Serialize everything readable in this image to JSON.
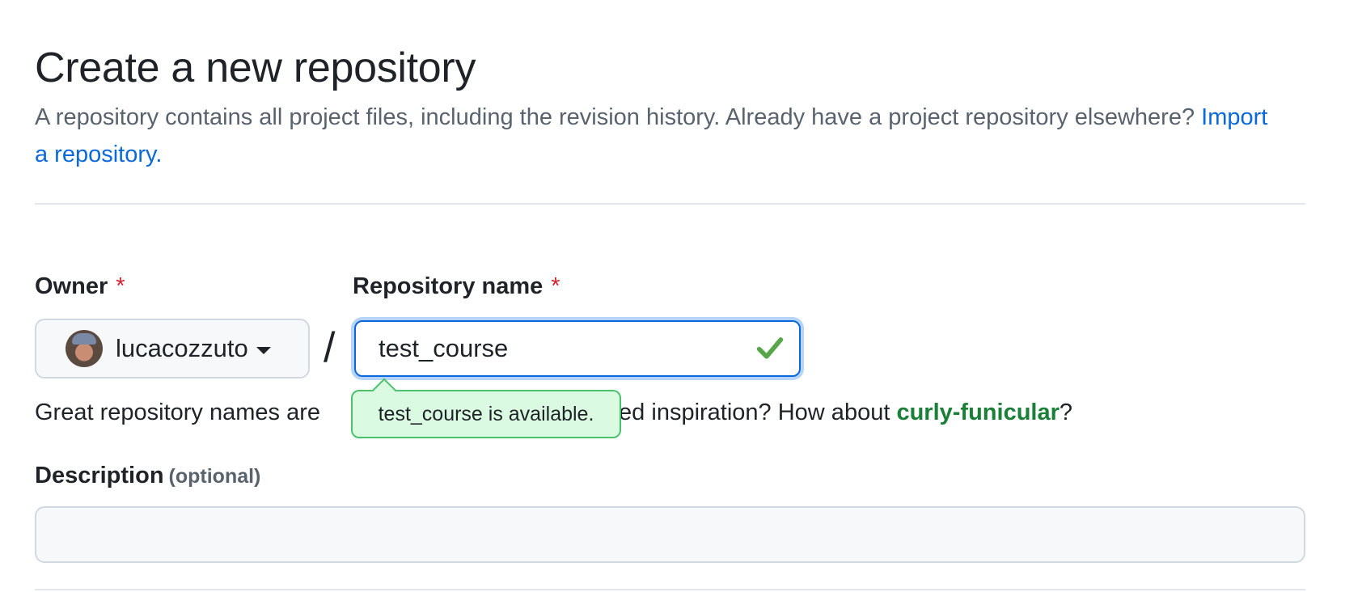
{
  "header": {
    "title": "Create a new repository",
    "subtitle_text": "A repository contains all project files, including the revision history. Already have a project repository elsewhere?",
    "import_link": "Import a repository."
  },
  "owner": {
    "label": "Owner",
    "required_mark": "*",
    "selected": "lucacozzuto",
    "avatar_icon": "avatar"
  },
  "separator": "/",
  "repo_name": {
    "label": "Repository name",
    "required_mark": "*",
    "value": "test_course",
    "status_icon": "check-icon",
    "availability_message": "test_course is available."
  },
  "helper": {
    "prefix": "Great repository names are",
    "suffix_question": "Need inspiration? How about",
    "suggestion": "curly-funicular",
    "end": "?"
  },
  "description": {
    "label": "Description",
    "optional_note": "(optional)",
    "value": ""
  },
  "colors": {
    "link": "#0969da",
    "success": "#1a7f37",
    "required": "#d1242f",
    "focus_border": "#0969da"
  }
}
